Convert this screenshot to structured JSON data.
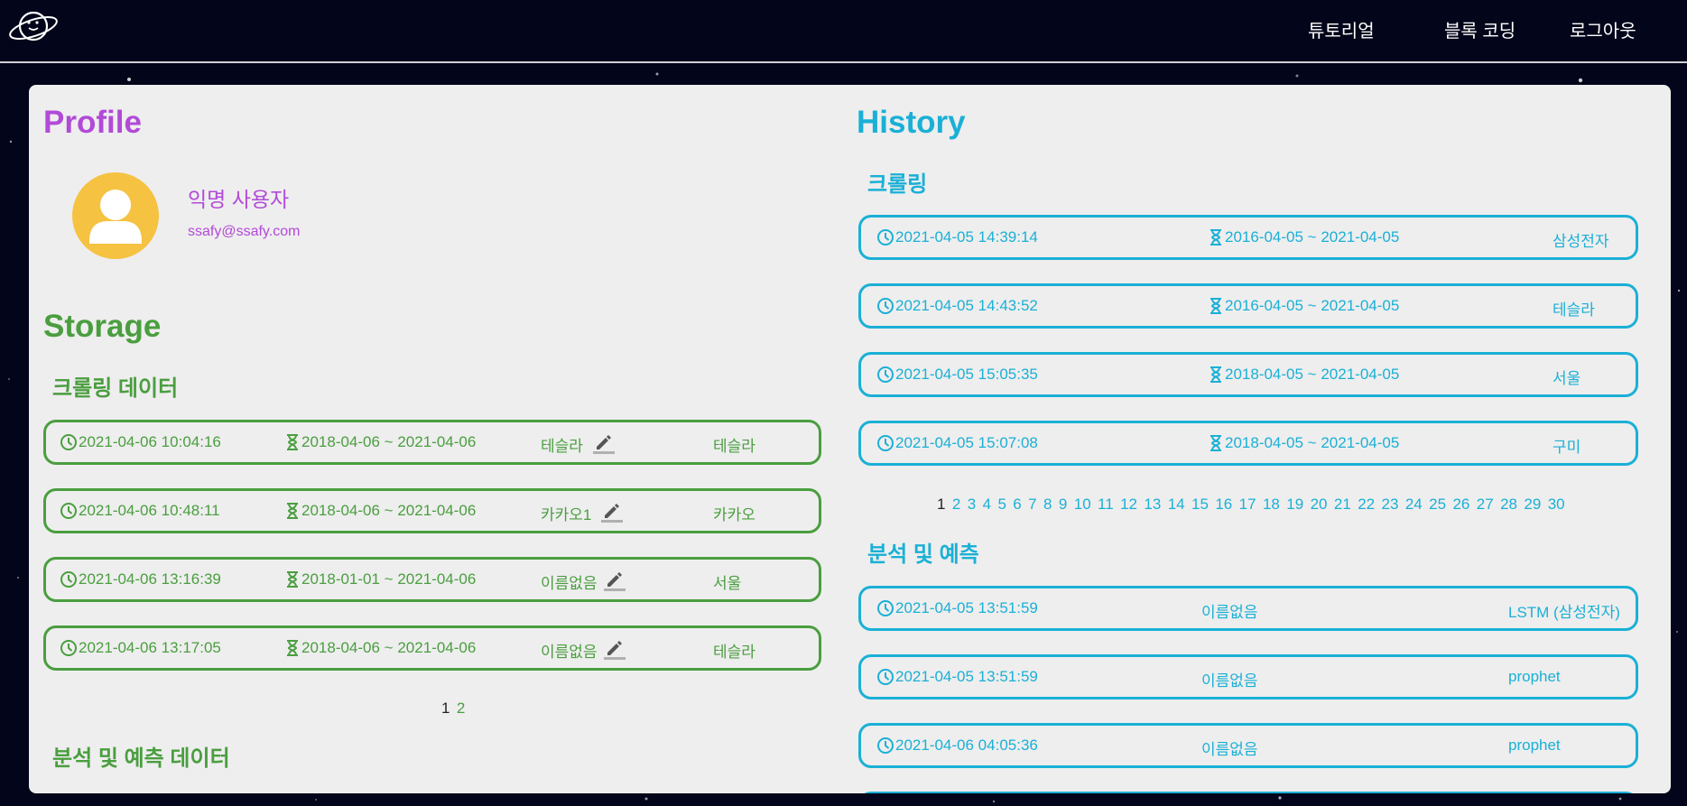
{
  "nav": {
    "links": [
      "튜토리얼",
      "블록 코딩",
      "로그아웃"
    ]
  },
  "profile": {
    "title": "Profile",
    "name": "익명 사용자",
    "email": "ssafy@ssafy.com"
  },
  "storage": {
    "title": "Storage",
    "crawling_title": "크롤링 데이터",
    "crawling_rows": [
      {
        "time": "2021-04-06 10:04:16",
        "range": "2018-04-06 ~ 2021-04-06",
        "name": "테슬라",
        "keyword": "테슬라"
      },
      {
        "time": "2021-04-06 10:48:11",
        "range": "2018-04-06 ~ 2021-04-06",
        "name": "카카오1",
        "keyword": "카카오"
      },
      {
        "time": "2021-04-06 13:16:39",
        "range": "2018-01-01 ~ 2021-04-06",
        "name": "이름없음",
        "keyword": "서울"
      },
      {
        "time": "2021-04-06 13:17:05",
        "range": "2018-04-06 ~ 2021-04-06",
        "name": "이름없음",
        "keyword": "테슬라"
      }
    ],
    "pages": [
      "1",
      "2"
    ],
    "current_page": "1",
    "analysis_title": "분석 및 예측 데이터"
  },
  "history": {
    "title": "History",
    "crawling_title": "크롤링",
    "crawling_rows": [
      {
        "time": "2021-04-05 14:39:14",
        "range": "2016-04-05 ~ 2021-04-05",
        "keyword": "삼성전자"
      },
      {
        "time": "2021-04-05 14:43:52",
        "range": "2016-04-05 ~ 2021-04-05",
        "keyword": "테슬라"
      },
      {
        "time": "2021-04-05 15:05:35",
        "range": "2018-04-05 ~ 2021-04-05",
        "keyword": "서울"
      },
      {
        "time": "2021-04-05 15:07:08",
        "range": "2018-04-05 ~ 2021-04-05",
        "keyword": "구미"
      }
    ],
    "pages": [
      "1",
      "2",
      "3",
      "4",
      "5",
      "6",
      "7",
      "8",
      "9",
      "10",
      "11",
      "12",
      "13",
      "14",
      "15",
      "16",
      "17",
      "18",
      "19",
      "20",
      "21",
      "22",
      "23",
      "24",
      "25",
      "26",
      "27",
      "28",
      "29",
      "30"
    ],
    "current_page": "1",
    "analysis_title": "분석 및 예측",
    "analysis_rows": [
      {
        "time": "2021-04-05 13:51:59",
        "name": "이름없음",
        "model": "LSTM (삼성전자)"
      },
      {
        "time": "2021-04-05 13:51:59",
        "name": "이름없음",
        "model": "prophet"
      },
      {
        "time": "2021-04-06 04:05:36",
        "name": "이름없음",
        "model": "prophet"
      }
    ]
  },
  "colors": {
    "background": "#03051a",
    "panel": "#eeeeee",
    "profile": "#b24ad8",
    "storage": "#4a9e3f",
    "history": "#1ab0d6",
    "avatar": "#f5c242"
  },
  "icons": [
    "planet-logo-icon",
    "clock-icon",
    "hourglass-icon",
    "pencil-icon",
    "user-icon"
  ]
}
